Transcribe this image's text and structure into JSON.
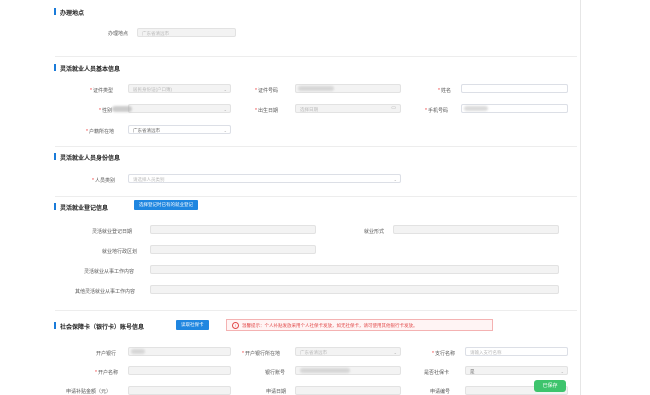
{
  "sections": {
    "office": "办理地点",
    "basic": "灵活就业人员基本信息",
    "identity": "灵活就业人员身份信息",
    "registration": "灵活就业登记信息",
    "bank": "社会保障卡（银行卡）账号信息"
  },
  "office": {
    "label": "办理地点",
    "value": "广东省清远市"
  },
  "basic": {
    "id_type_label": "证件类型",
    "id_type_value": "居民身份证(户口簿)",
    "id_no_label": "证件号码",
    "name_label": "姓名",
    "gender_label": "性别",
    "birth_label": "出生日期",
    "birth_placeholder": "选择日期",
    "phone_label": "手机号码",
    "huji_label": "户籍所在地",
    "huji_value": "广东省清远市"
  },
  "identity": {
    "type_label": "人员类别",
    "type_placeholder": "请选择人员类别"
  },
  "registration": {
    "button": "选择登记时已有的就业登记",
    "reg_date_label": "灵活就业登记日期",
    "form_label": "就业形式",
    "district_label": "就业地行政区划",
    "work_label": "灵活就业从事工作内容",
    "other_label": "其他灵活就业从事工作内容"
  },
  "bank": {
    "button": "读取社保卡",
    "warning": "温馨提示：个人补贴发放采用个人社保卡发放，如无社保卡，请可使用其他银行卡发放。",
    "bank_label": "开户银行",
    "bank_region_label": "开户银行所在地",
    "bank_region_value": "广东省清远市",
    "branch_label": "支行名称",
    "branch_placeholder": "请输入支行名称",
    "account_name_label": "开户名称",
    "account_no_label": "银行账号",
    "is_sscard_label": "是否社保卡",
    "is_sscard_value": "是",
    "amount_label": "申请补贴金额（元）",
    "apply_date_label": "申请日期",
    "apply_no_label": "申请编号"
  },
  "fab": "已保存",
  "colors": {
    "accent": "#1f86e0",
    "required": "#e33333",
    "warning": "#e24a4a",
    "fab": "#3ec46d"
  }
}
